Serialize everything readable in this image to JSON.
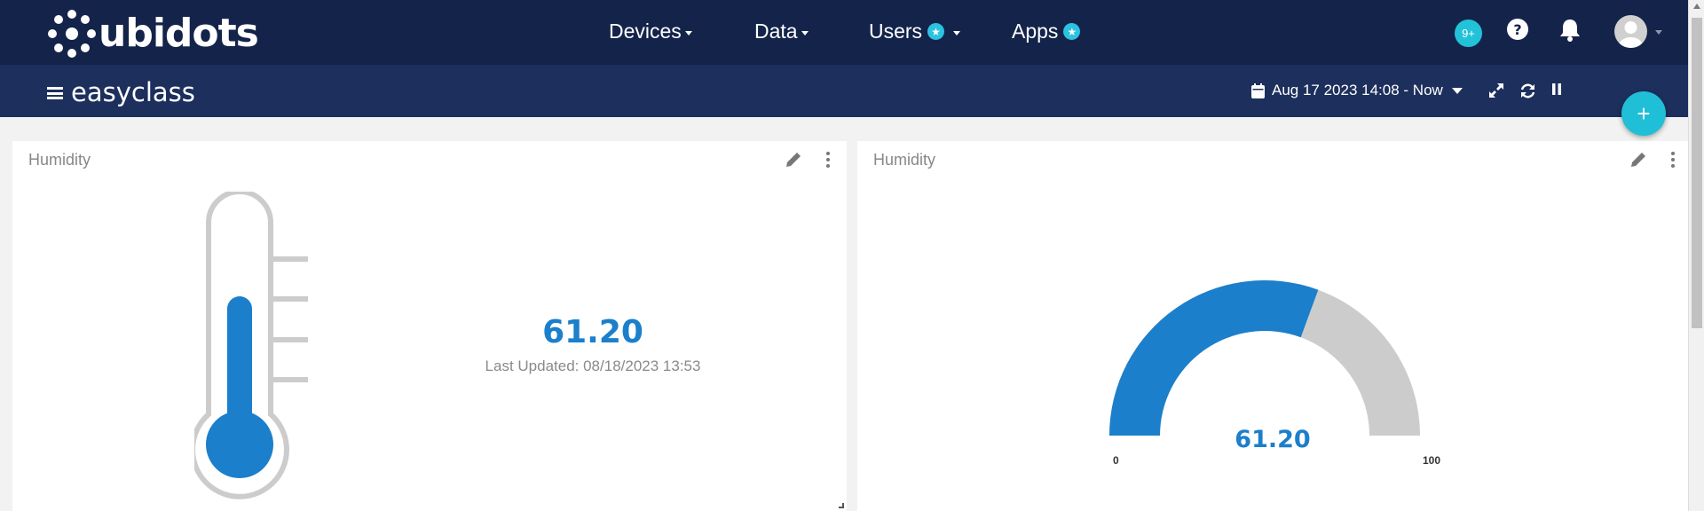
{
  "brand": {
    "name": "ubidots"
  },
  "nav": {
    "items": [
      {
        "label": "Devices",
        "has_caret": true,
        "star": false
      },
      {
        "label": "Data",
        "has_caret": true,
        "star": false
      },
      {
        "label": "Users",
        "has_caret": true,
        "star": true
      },
      {
        "label": "Apps",
        "has_caret": false,
        "star": true
      }
    ],
    "notifications_badge": "9+",
    "icons": [
      "help-icon",
      "bell-icon",
      "avatar"
    ]
  },
  "dashboard": {
    "title": "easyclass",
    "date_range": "Aug 17 2023 14:08 - Now",
    "icons": [
      "calendar-icon",
      "expand-icon",
      "refresh-icon",
      "pause-icon",
      "add-widget-icon"
    ]
  },
  "widgets": [
    {
      "title": "Humidity",
      "type": "thermometer",
      "value": "61.20",
      "last_updated": "Last Updated: 08/18/2023 13:53",
      "fill_fraction": 0.612
    },
    {
      "title": "Humidity",
      "type": "gauge",
      "value": "61.20",
      "min": "0",
      "max": "100",
      "fill_fraction": 0.612
    }
  ],
  "colors": {
    "nav_bg": "#14234a",
    "subbar_bg": "#1d2f5c",
    "accent": "#1b7fcb",
    "badge": "#22c2d8",
    "gauge_empty": "#cccccc"
  }
}
